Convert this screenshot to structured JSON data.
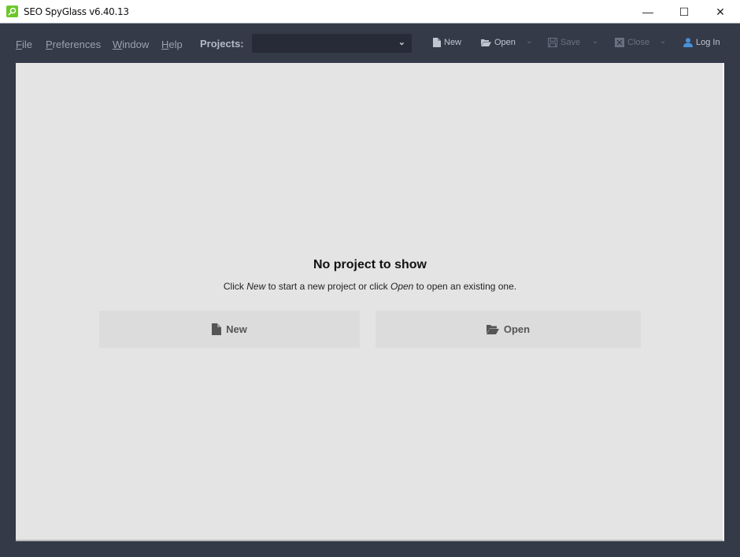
{
  "window": {
    "title": "SEO SpyGlass v6.40.13",
    "controls": {
      "minimize": "—",
      "maximize": "☐",
      "close": "✕"
    }
  },
  "menu": {
    "items": [
      {
        "label_first": "F",
        "label_rest": "ile"
      },
      {
        "label_first": "P",
        "label_rest": "references"
      },
      {
        "label_first": "W",
        "label_rest": "indow"
      },
      {
        "label_first": "H",
        "label_rest": "elp"
      }
    ],
    "projects_label": "Projects:",
    "projects_value": ""
  },
  "toolbar": {
    "new": {
      "label": "New",
      "icon": "file-icon",
      "enabled": true
    },
    "open": {
      "label": "Open",
      "icon": "folder-open-icon",
      "enabled": true
    },
    "save": {
      "label": "Save",
      "icon": "save-icon",
      "enabled": false
    },
    "close": {
      "label": "Close",
      "icon": "close-box-icon",
      "enabled": false
    },
    "login": {
      "label": "Log In",
      "icon": "user-icon",
      "enabled": true
    }
  },
  "main": {
    "title": "No project to show",
    "hint": {
      "part1": "Click ",
      "new_em": "New",
      "part2": " to start a new project or click ",
      "open_em": "Open",
      "part3": " to open an existing one."
    },
    "buttons": {
      "new_label": "New",
      "open_label": "Open"
    }
  },
  "colors": {
    "accent_green": "#6cc72a",
    "toolbar_bg": "#343a48",
    "content_bg": "#e4e4e4",
    "user_icon": "#4a90d9"
  }
}
